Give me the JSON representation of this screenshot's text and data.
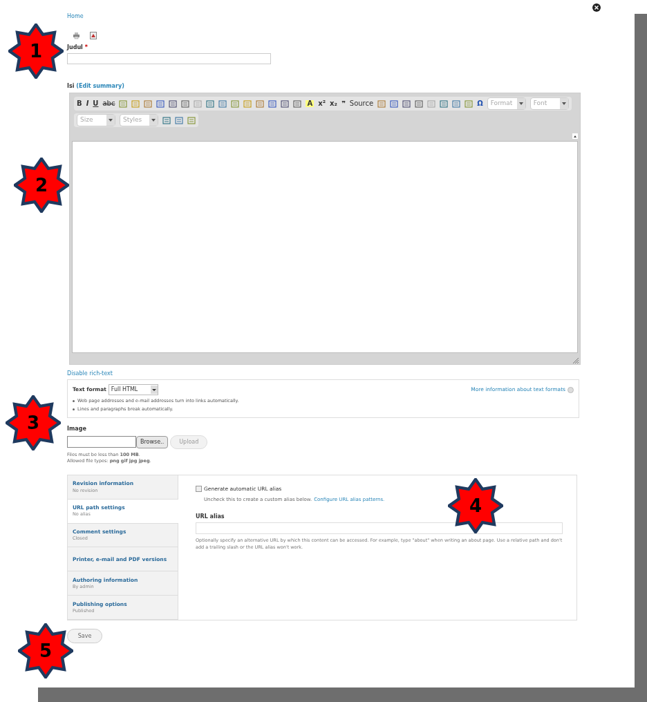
{
  "breadcrumb": "Home",
  "title_field": {
    "label": "Judul",
    "required_mark": "*"
  },
  "body_field": {
    "label": "Isi",
    "link": "(Edit summary)"
  },
  "toolbar_row_1": [
    {
      "kind": "bold",
      "label": "B"
    },
    {
      "kind": "italic",
      "label": "I"
    },
    {
      "kind": "underline",
      "label": "U"
    },
    {
      "kind": "strike",
      "label": "abc"
    },
    {
      "kind": "icon"
    },
    {
      "kind": "icon"
    },
    {
      "kind": "icon"
    },
    {
      "kind": "icon"
    },
    {
      "kind": "icon"
    },
    {
      "kind": "icon"
    },
    {
      "kind": "icon"
    },
    {
      "kind": "icon"
    },
    {
      "kind": "icon"
    },
    {
      "kind": "icon"
    },
    {
      "kind": "icon"
    },
    {
      "kind": "icon"
    },
    {
      "kind": "icon"
    },
    {
      "kind": "icon"
    },
    {
      "kind": "icon"
    },
    {
      "kind": "highlight",
      "label": "A"
    },
    {
      "kind": "glyph",
      "label": "x²"
    },
    {
      "kind": "glyph",
      "label": "x₂"
    },
    {
      "kind": "glyph",
      "label": "❞"
    },
    {
      "kind": "source",
      "label": "Source"
    },
    {
      "kind": "icon"
    },
    {
      "kind": "icon"
    },
    {
      "kind": "icon"
    },
    {
      "kind": "icon"
    },
    {
      "kind": "icon"
    },
    {
      "kind": "icon"
    },
    {
      "kind": "icon"
    },
    {
      "kind": "icon"
    },
    {
      "kind": "symbol",
      "label": "Ω"
    },
    {
      "kind": "select",
      "label": "Format"
    },
    {
      "kind": "select",
      "label": "Font"
    }
  ],
  "toolbar_row_2": [
    {
      "kind": "select",
      "label": "Size"
    },
    {
      "kind": "select",
      "label": "Styles"
    },
    {
      "kind": "icon"
    },
    {
      "kind": "icon"
    },
    {
      "kind": "icon"
    }
  ],
  "disable_link": "Disable rich-text",
  "text_format": {
    "label": "Text format",
    "value": "Full HTML",
    "more_link": "More information about text formats",
    "tips": [
      "Web page addresses and e-mail addresses turn into links automatically.",
      "Lines and paragraphs break automatically."
    ]
  },
  "image_field": {
    "label": "Image",
    "browse": "Browse..",
    "upload": "Upload",
    "help": [
      "Files must be less than **100 MB**.",
      "Allowed file types: **png gif jpg jpeg**."
    ]
  },
  "vertical_tabs": [
    {
      "title": "Revision information",
      "summary": "No revision",
      "selected": false
    },
    {
      "title": "URL path settings",
      "summary": "No alias",
      "selected": true
    },
    {
      "title": "Comment settings",
      "summary": "Closed",
      "selected": false
    },
    {
      "title": "Printer, e-mail and PDF versions",
      "selected": false
    },
    {
      "title": "Authoring information",
      "summary": "By admin",
      "selected": false
    },
    {
      "title": "Publishing options",
      "summary": "Published",
      "selected": false
    }
  ],
  "url_settings": {
    "auto_alias": {
      "label": "Generate automatic URL alias",
      "checked": false
    },
    "auto_help": "Uncheck this to create a custom alias below.",
    "auto_link": "Configure URL alias patterns.",
    "alias_label": "URL alias",
    "alias_help": "Optionally specify an alternative URL by which this content can be accessed. For example, type \"about\" when writing an about page. Use a relative path and don't add a trailing slash or the URL alias won't work."
  },
  "save_button": "Save",
  "callouts": [
    "1",
    "2",
    "3",
    "4",
    "5"
  ]
}
